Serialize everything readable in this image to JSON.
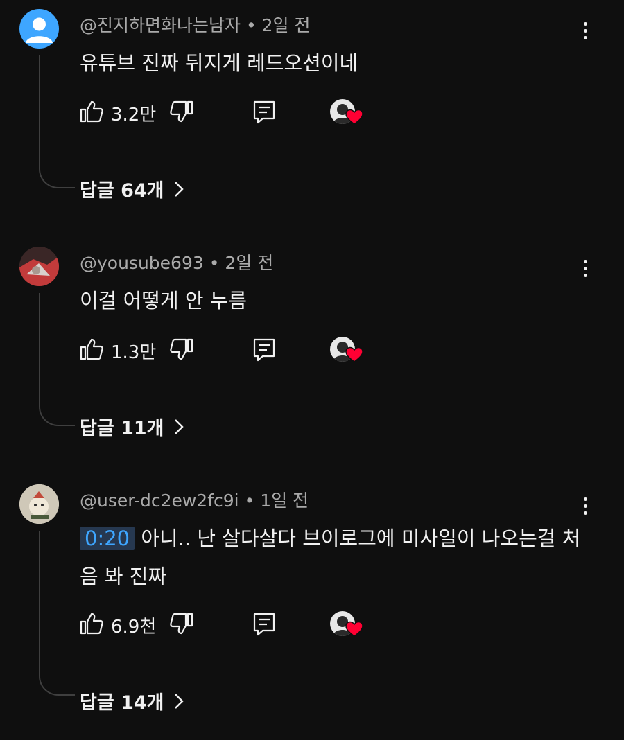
{
  "comments": [
    {
      "handle": "@진지하면화나는남자",
      "time": "2일 전",
      "text": "유튜브 진짜 뒤지게 레드오션이네",
      "likes": "3.2만",
      "replies": "답글 64개"
    },
    {
      "handle": "@yousube693",
      "time": "2일 전",
      "text": "이걸 어떻게 안 누름",
      "likes": "1.3만",
      "replies": "답글 11개"
    },
    {
      "handle": "@user-dc2ew2fc9i",
      "time": "1일 전",
      "timestamp": "0:20",
      "text": "아니.. 난 살다살다 브이로그에 미사일이 나오는걸 처음 봐 진짜",
      "likes": "6.9천",
      "replies": "답글 14개"
    }
  ],
  "separator": " • ",
  "colors": {
    "background": "#0f0f0f",
    "text": "#f1f1f1",
    "meta": "#aaaaaa",
    "link": "#3ea6ff",
    "heart": "#ff0033",
    "default_avatar": "#3ea6ff"
  },
  "icons": [
    "person-icon",
    "more-vert-icon",
    "thumb-up-icon",
    "thumb-down-icon",
    "reply-icon",
    "heart-icon",
    "chevron-right-icon"
  ]
}
